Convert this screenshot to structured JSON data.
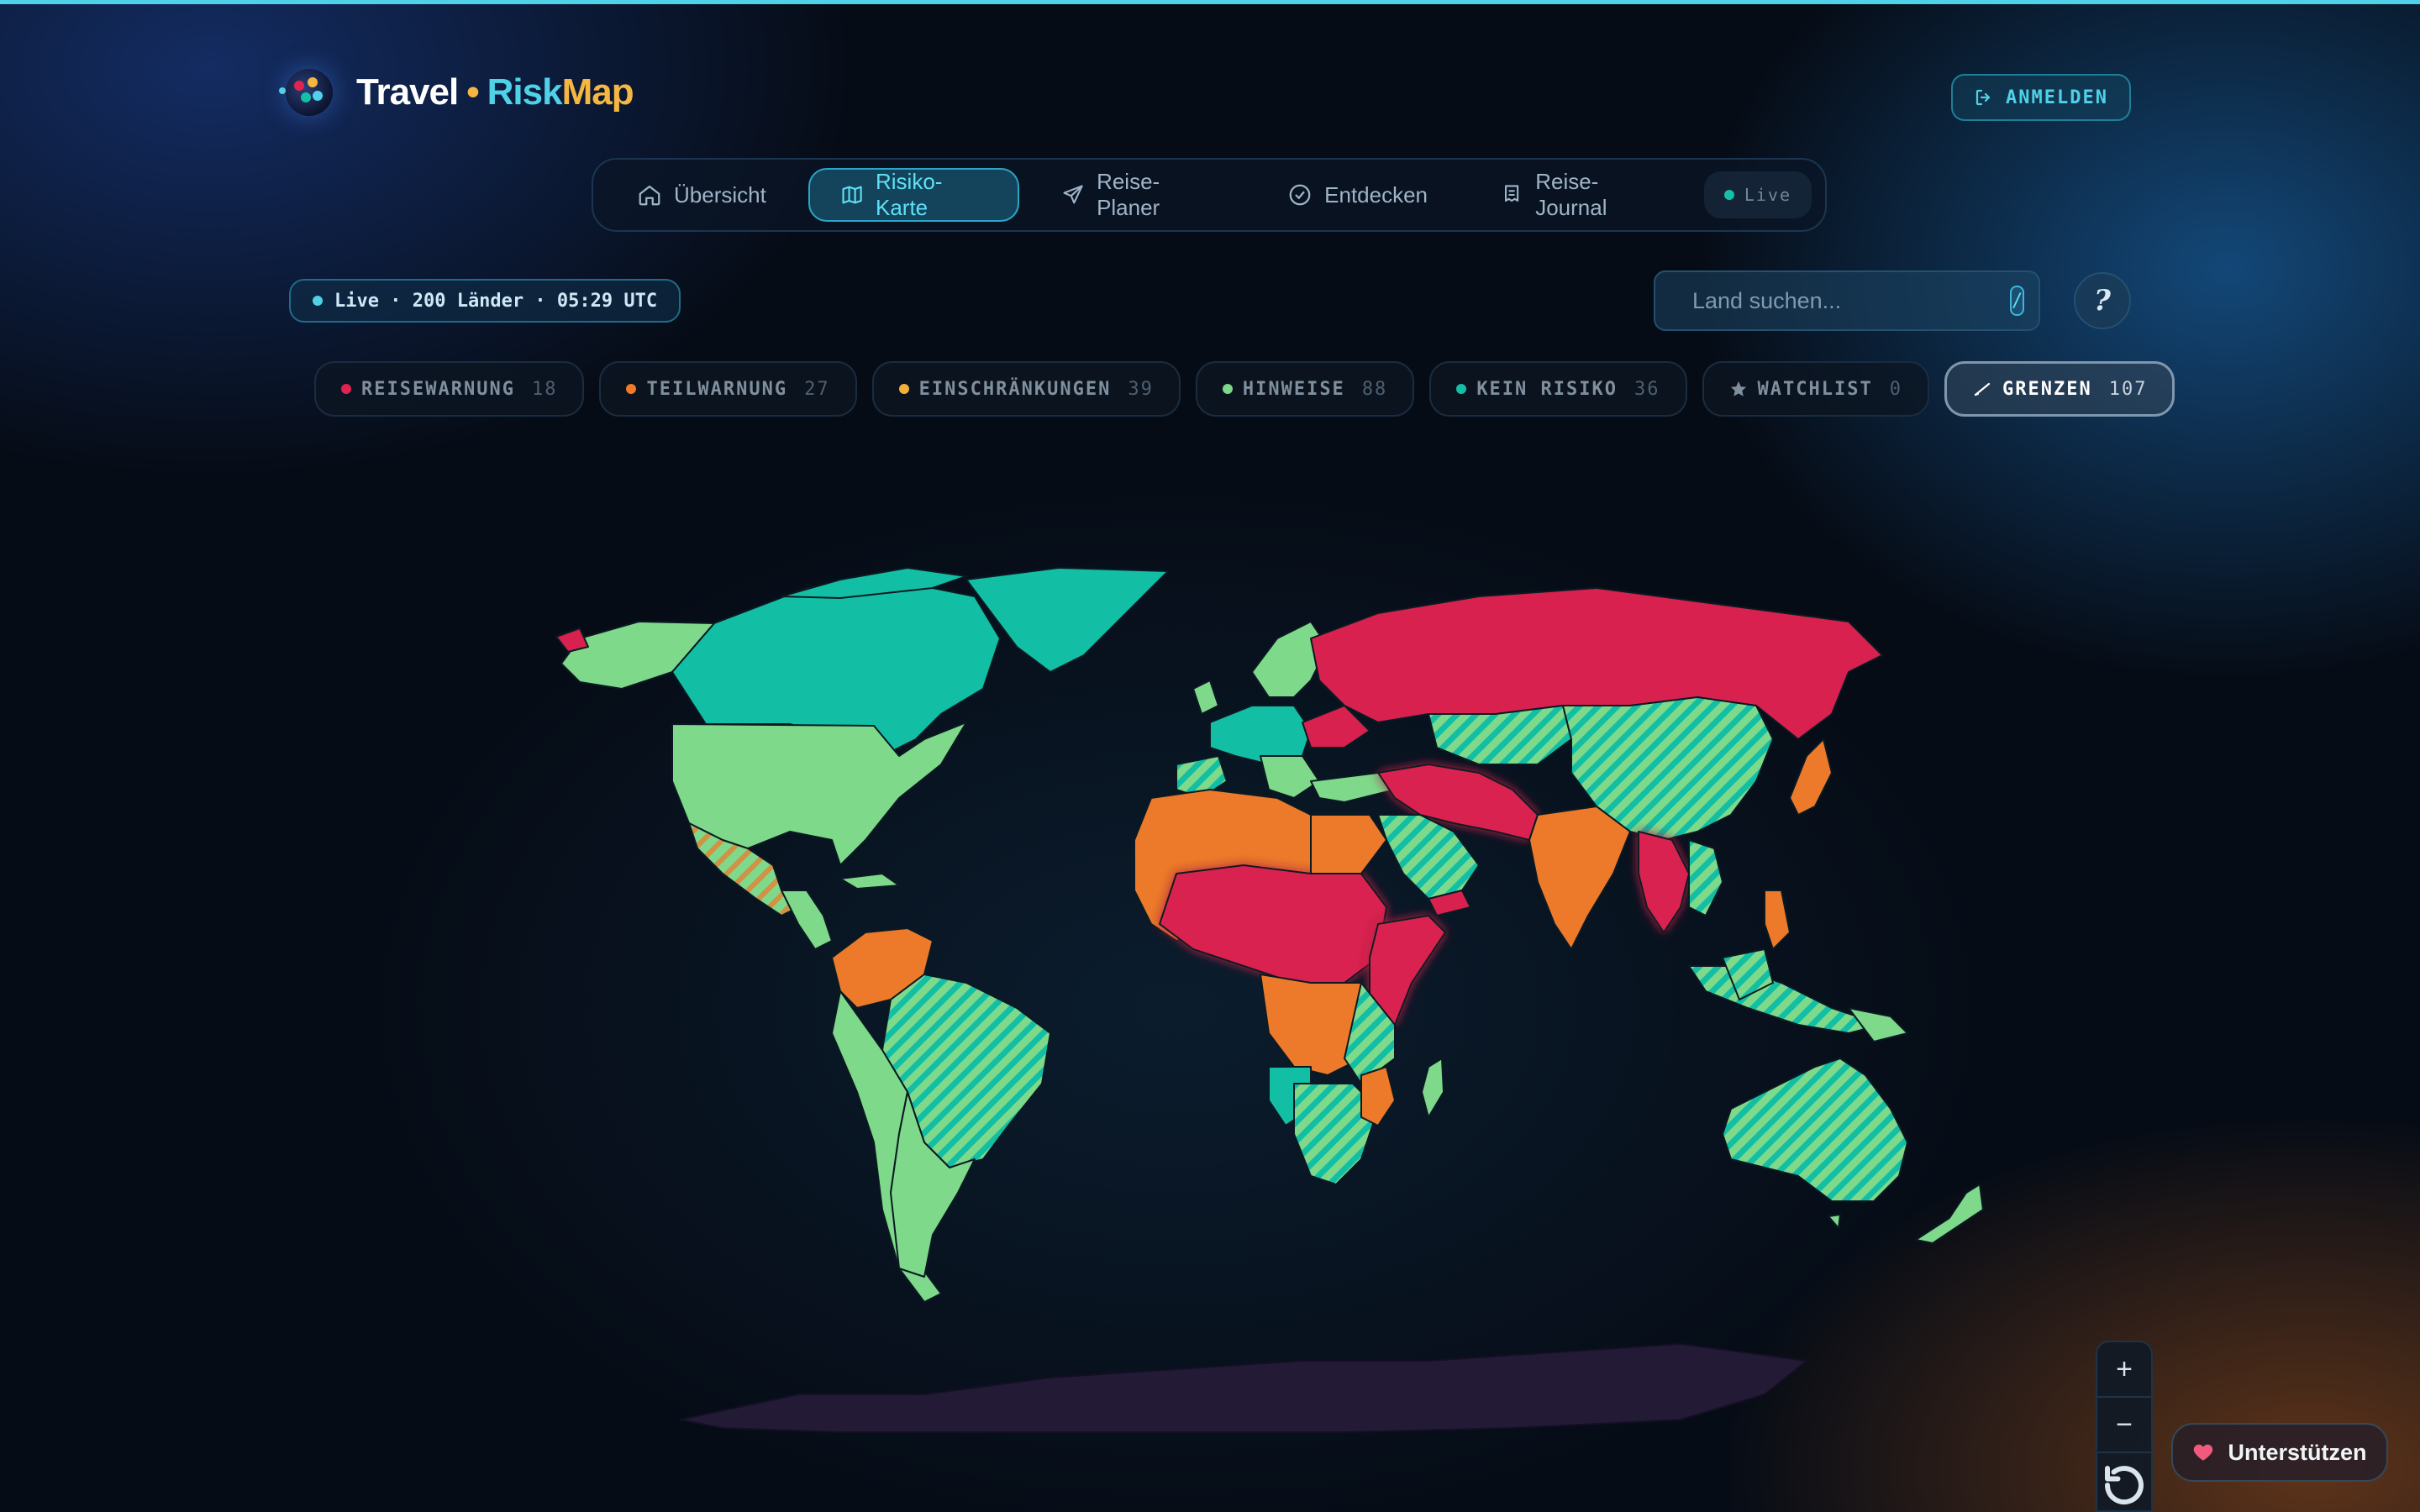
{
  "brand": {
    "travel": "Travel",
    "separator": "•",
    "risk": "Risk",
    "map": "Map"
  },
  "header": {
    "login_label": "ANMELDEN"
  },
  "nav": {
    "items": [
      {
        "label": "Übersicht",
        "icon": "home-icon",
        "active": false
      },
      {
        "label": "Risiko-Karte",
        "icon": "map-icon",
        "active": true
      },
      {
        "label": "Reise-Planer",
        "icon": "send-icon",
        "active": false
      },
      {
        "label": "Entdecken",
        "icon": "check-circle-icon",
        "active": false
      },
      {
        "label": "Reise-Journal",
        "icon": "journal-icon",
        "active": false
      }
    ],
    "live_label": "Live"
  },
  "status": {
    "text": "Live · 200 Länder · 05:29 UTC"
  },
  "search": {
    "placeholder": "Land suchen...",
    "shortcut": "/"
  },
  "help": {
    "label": "?"
  },
  "filters": [
    {
      "label": "REISEWARNUNG",
      "count": "18",
      "color": "#e0244f",
      "active": false
    },
    {
      "label": "TEILWARNUNG",
      "count": "27",
      "color": "#f07a26",
      "active": false
    },
    {
      "label": "EINSCHRÄNKUNGEN",
      "count": "39",
      "color": "#f2b13a",
      "active": false
    },
    {
      "label": "HINWEISE",
      "count": "88",
      "color": "#7dd88a",
      "active": false
    },
    {
      "label": "KEIN RISIKO",
      "count": "36",
      "color": "#15bfa6",
      "active": false
    },
    {
      "label": "WATCHLIST",
      "count": "0",
      "icon": "star-icon",
      "active": false
    },
    {
      "label": "GRENZEN",
      "count": "107",
      "icon": "line-icon",
      "active": true
    }
  ],
  "colors": {
    "reisewarnung": "#d9214f",
    "teilwarnung": "#ec7a2a",
    "hinweise": "#7fd98b",
    "kein_risiko": "#12bfa5",
    "antarctica": "#231b36",
    "accent": "#4fd1e8",
    "brand_gold": "#f5b642"
  },
  "zoom": {
    "in_label": "+",
    "out_label": "−"
  },
  "support": {
    "label": "Unterstützen"
  }
}
